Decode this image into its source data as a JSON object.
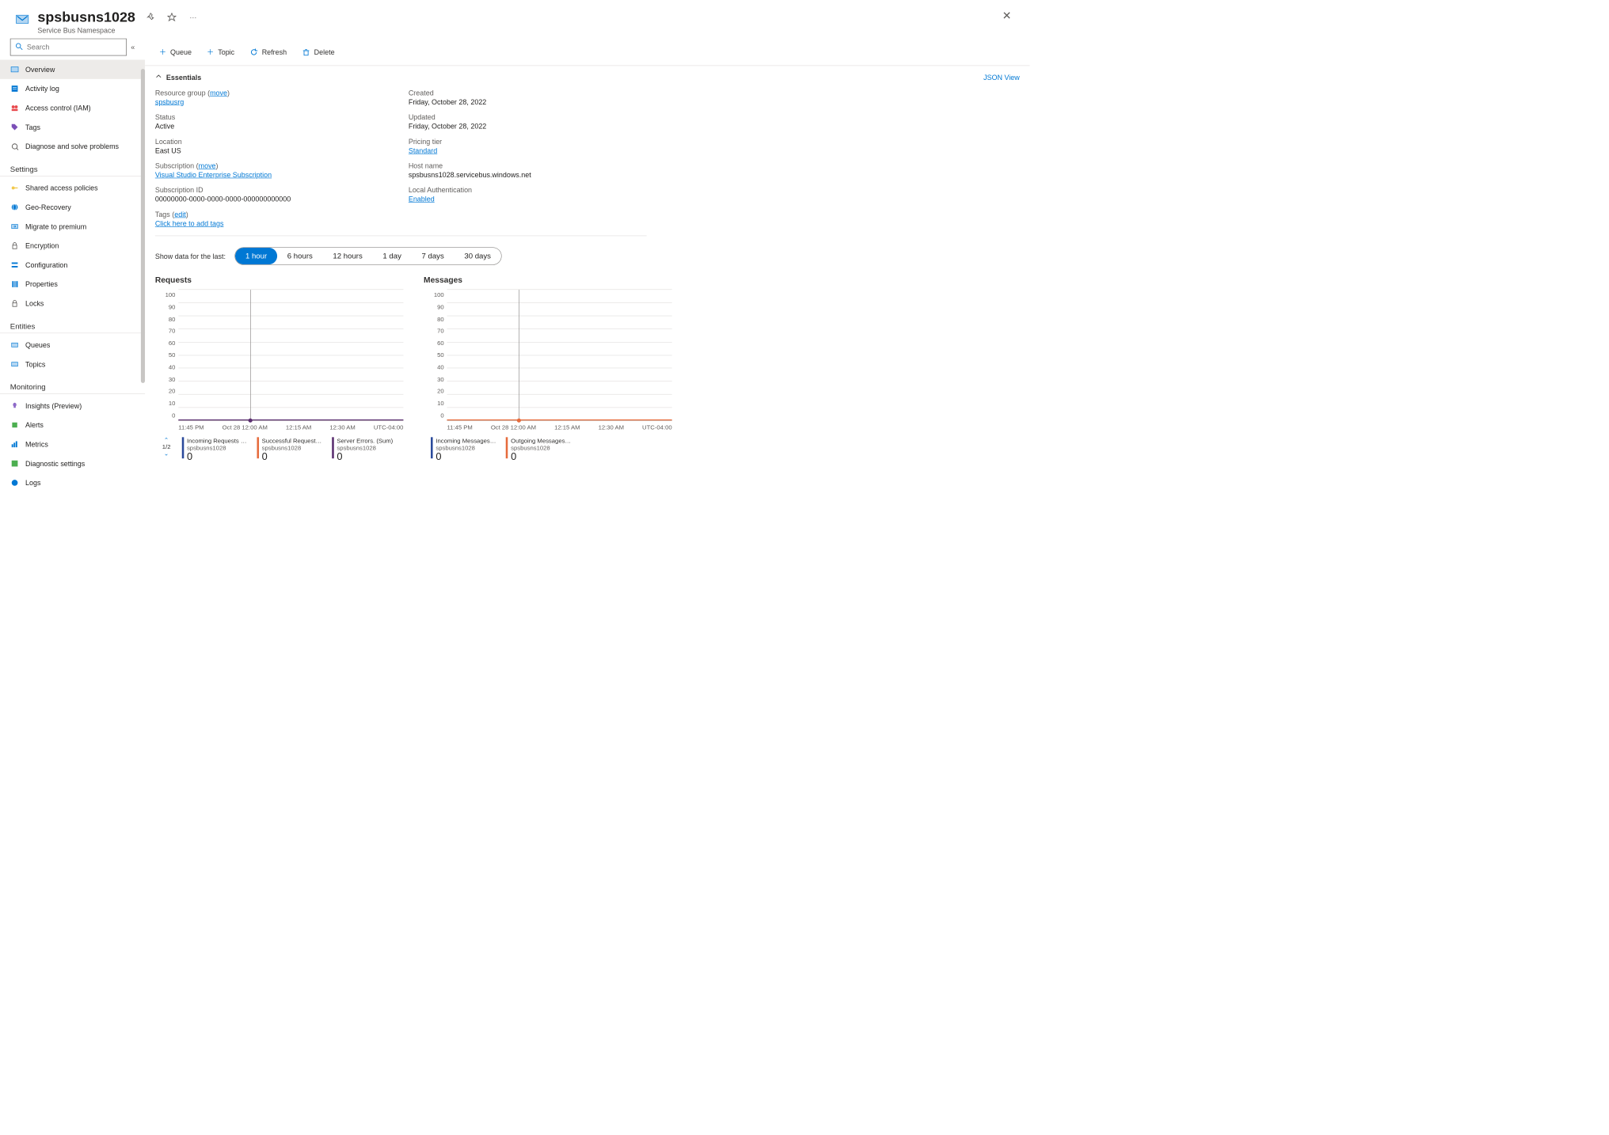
{
  "header": {
    "title": "spsbusns1028",
    "subtitle": "Service Bus Namespace"
  },
  "sidebar": {
    "search_placeholder": "Search",
    "items": [
      {
        "label": "Overview",
        "icon": "overview",
        "active": true
      },
      {
        "label": "Activity log",
        "icon": "activity-log"
      },
      {
        "label": "Access control (IAM)",
        "icon": "access-control"
      },
      {
        "label": "Tags",
        "icon": "tags"
      },
      {
        "label": "Diagnose and solve problems",
        "icon": "diagnose"
      }
    ],
    "sections": [
      {
        "title": "Settings",
        "items": [
          {
            "label": "Shared access policies",
            "icon": "key"
          },
          {
            "label": "Geo-Recovery",
            "icon": "globe"
          },
          {
            "label": "Migrate to premium",
            "icon": "migrate"
          },
          {
            "label": "Encryption",
            "icon": "lock"
          },
          {
            "label": "Configuration",
            "icon": "config"
          },
          {
            "label": "Properties",
            "icon": "properties"
          },
          {
            "label": "Locks",
            "icon": "lock2"
          }
        ]
      },
      {
        "title": "Entities",
        "items": [
          {
            "label": "Queues",
            "icon": "queues"
          },
          {
            "label": "Topics",
            "icon": "topics"
          }
        ]
      },
      {
        "title": "Monitoring",
        "items": [
          {
            "label": "Insights (Preview)",
            "icon": "insights"
          },
          {
            "label": "Alerts",
            "icon": "alerts"
          },
          {
            "label": "Metrics",
            "icon": "metrics"
          },
          {
            "label": "Diagnostic settings",
            "icon": "diag"
          },
          {
            "label": "Logs",
            "icon": "logs"
          }
        ]
      }
    ]
  },
  "toolbar": {
    "queue": "Queue",
    "topic": "Topic",
    "refresh": "Refresh",
    "delete": "Delete"
  },
  "essentials": {
    "heading": "Essentials",
    "json_view": "JSON View",
    "left": {
      "resource_group_label": "Resource group",
      "resource_group_move": "move",
      "resource_group_value": "spsbusrg",
      "status_label": "Status",
      "status_value": "Active",
      "location_label": "Location",
      "location_value": "East US",
      "subscription_label": "Subscription",
      "subscription_move": "move",
      "subscription_value": "Visual Studio Enterprise Subscription",
      "subscription_id_label": "Subscription ID",
      "subscription_id_value": "00000000-0000-0000-0000-000000000000"
    },
    "right": {
      "created_label": "Created",
      "created_value": "Friday, October 28, 2022",
      "updated_label": "Updated",
      "updated_value": "Friday, October 28, 2022",
      "pricing_label": "Pricing tier",
      "pricing_value": "Standard",
      "hostname_label": "Host name",
      "hostname_value": "spsbusns1028.servicebus.windows.net",
      "localauth_label": "Local Authentication",
      "localauth_value": "Enabled"
    },
    "tags_label": "Tags",
    "tags_edit": "edit",
    "tags_add": "Click here to add tags"
  },
  "time_range": {
    "label": "Show data for the last:",
    "options": [
      "1 hour",
      "6 hours",
      "12 hours",
      "1 day",
      "7 days",
      "30 days"
    ],
    "selected": 0
  },
  "charts": {
    "tz": "UTC-04:00",
    "x_ticks": [
      "11:45 PM",
      "Oct 28 12:00 AM",
      "12:15 AM",
      "12:30 AM"
    ],
    "y_ticks": [
      "100",
      "90",
      "80",
      "70",
      "60",
      "50",
      "40",
      "30",
      "20",
      "10",
      "0"
    ],
    "requests": {
      "title": "Requests",
      "pager": "1/2",
      "series": [
        {
          "name": "Incoming Requests (Sum)",
          "sub": "spsbusns1028",
          "value": "0",
          "color": "#2b4a9b"
        },
        {
          "name": "Successful Requests …",
          "sub": "spsbusns1028",
          "value": "0",
          "color": "#e66b3c"
        },
        {
          "name": "Server Errors. (Sum)",
          "sub": "spsbusns1028",
          "value": "0",
          "color": "#5a2e6f"
        }
      ]
    },
    "messages": {
      "title": "Messages",
      "series": [
        {
          "name": "Incoming Messages (Sum)",
          "sub": "spsbusns1028",
          "value": "0",
          "color": "#2b4a9b"
        },
        {
          "name": "Outgoing Messages (Sum)",
          "sub": "spsbusns1028",
          "value": "0",
          "color": "#e66b3c"
        }
      ]
    }
  },
  "chart_data": [
    {
      "type": "line",
      "title": "Requests",
      "x": [
        "11:45 PM",
        "12:00 AM",
        "12:15 AM",
        "12:30 AM"
      ],
      "series": [
        {
          "name": "Incoming Requests (Sum)",
          "values": [
            0,
            0,
            0,
            0
          ]
        },
        {
          "name": "Successful Requests (Sum)",
          "values": [
            0,
            0,
            0,
            0
          ]
        },
        {
          "name": "Server Errors. (Sum)",
          "values": [
            0,
            0,
            0,
            0
          ]
        }
      ],
      "ylim": [
        0,
        100
      ],
      "xlabel": "",
      "ylabel": ""
    },
    {
      "type": "line",
      "title": "Messages",
      "x": [
        "11:45 PM",
        "12:00 AM",
        "12:15 AM",
        "12:30 AM"
      ],
      "series": [
        {
          "name": "Incoming Messages (Sum)",
          "values": [
            0,
            0,
            0,
            0
          ]
        },
        {
          "name": "Outgoing Messages (Sum)",
          "values": [
            0,
            0,
            0,
            0
          ]
        }
      ],
      "ylim": [
        0,
        100
      ],
      "xlabel": "",
      "ylabel": ""
    }
  ]
}
